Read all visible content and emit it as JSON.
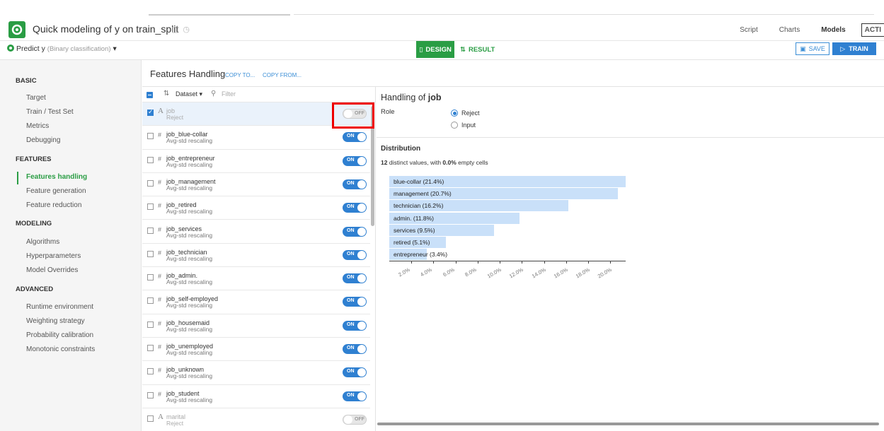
{
  "app": {
    "title": "Quick modeling of y on train_split",
    "nav": [
      "Script",
      "Charts",
      "Models",
      "ACTI"
    ],
    "active_nav": "Models"
  },
  "subbar": {
    "predict_label": "Predict y",
    "predict_type": "(Binary classification)",
    "design_label": "DESIGN",
    "result_label": "RESULT",
    "save_label": "SAVE",
    "train_label": "TRAIN"
  },
  "sidebar": {
    "sections": [
      {
        "heading": "BASIC",
        "items": [
          "Target",
          "Train / Test Set",
          "Metrics",
          "Debugging"
        ]
      },
      {
        "heading": "FEATURES",
        "items": [
          "Features handling",
          "Feature generation",
          "Feature reduction"
        ]
      },
      {
        "heading": "MODELING",
        "items": [
          "Algorithms",
          "Hyperparameters",
          "Model Overrides"
        ]
      },
      {
        "heading": "ADVANCED",
        "items": [
          "Runtime environment",
          "Weighting strategy",
          "Probability calibration",
          "Monotonic constraints"
        ]
      }
    ],
    "active_item": "Features handling"
  },
  "features": {
    "title": "Features Handling",
    "copy_to": "COPY TO...",
    "copy_from": "COPY FROM...",
    "sort_label": "Dataset",
    "filter_placeholder": "Filter",
    "rows": [
      {
        "name": "job",
        "handling": "Reject",
        "type": "A",
        "on": false
      },
      {
        "name": "job_blue-collar",
        "handling": "Avg-std rescaling",
        "type": "#",
        "on": true
      },
      {
        "name": "job_entrepreneur",
        "handling": "Avg-std rescaling",
        "type": "#",
        "on": true
      },
      {
        "name": "job_management",
        "handling": "Avg-std rescaling",
        "type": "#",
        "on": true
      },
      {
        "name": "job_retired",
        "handling": "Avg-std rescaling",
        "type": "#",
        "on": true
      },
      {
        "name": "job_services",
        "handling": "Avg-std rescaling",
        "type": "#",
        "on": true
      },
      {
        "name": "job_technician",
        "handling": "Avg-std rescaling",
        "type": "#",
        "on": true
      },
      {
        "name": "job_admin.",
        "handling": "Avg-std rescaling",
        "type": "#",
        "on": true
      },
      {
        "name": "job_self-employed",
        "handling": "Avg-std rescaling",
        "type": "#",
        "on": true
      },
      {
        "name": "job_housemaid",
        "handling": "Avg-std rescaling",
        "type": "#",
        "on": true
      },
      {
        "name": "job_unemployed",
        "handling": "Avg-std rescaling",
        "type": "#",
        "on": true
      },
      {
        "name": "job_unknown",
        "handling": "Avg-std rescaling",
        "type": "#",
        "on": true
      },
      {
        "name": "job_student",
        "handling": "Avg-std rescaling",
        "type": "#",
        "on": true
      },
      {
        "name": "marital",
        "handling": "Reject",
        "type": "A",
        "on": false
      }
    ],
    "toggle_on": "ON",
    "toggle_off": "OFF"
  },
  "detail": {
    "title_prefix": "Handling of",
    "feature": "job",
    "role_label": "Role",
    "role_options": [
      "Reject",
      "Input"
    ],
    "role_selected": "Reject",
    "dist_title": "Distribution",
    "dist_count": "12",
    "dist_mid": " distinct values, with ",
    "dist_pct": "0.0%",
    "dist_tail": " empty cells"
  },
  "chart_data": {
    "type": "bar",
    "orientation": "horizontal",
    "categories": [
      "blue-collar",
      "management",
      "technician",
      "admin.",
      "services",
      "retired",
      "entrepreneur"
    ],
    "labels": [
      "blue-collar (21.4%)",
      "management (20.7%)",
      "technician (16.2%)",
      "admin. (11.8%)",
      "services (9.5%)",
      "retired (5.1%)",
      "entrepreneur (3.4%)"
    ],
    "values": [
      21.4,
      20.7,
      16.2,
      11.8,
      9.5,
      5.1,
      3.4
    ],
    "xticks": [
      "2.0%",
      "4.0%",
      "6.0%",
      "8.0%",
      "10.0%",
      "12.0%",
      "14.0%",
      "16.0%",
      "18.0%",
      "20.0%"
    ],
    "xlim": [
      0,
      21.4
    ],
    "bar_color": "#c9e0f9"
  }
}
